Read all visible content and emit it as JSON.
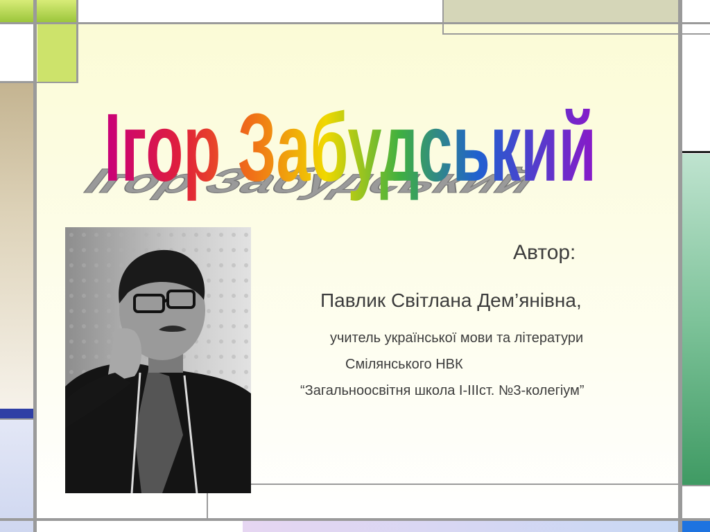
{
  "slide": {
    "title": "Ігор Забудський",
    "author_label": "Автор:",
    "author_name": "Павлик Світлана Дем’янівна,",
    "author_role": "учитель української мови та літератури",
    "author_school": "Смілянського НВК",
    "author_school_full": "“Загальноосвітня школа І-ІІІст. №3-колегіум”"
  },
  "photo": {
    "subject": "portrait-photo"
  },
  "colors": {
    "lime": "#cde36b",
    "lime_dark": "#9cc63c",
    "khaki": "#d5d6b8",
    "tan": "#c4b491",
    "green_top": "#bfe3cf",
    "green_bottom": "#3f9a63",
    "navy": "#2f3fa5",
    "lavender": "#cfd7f0",
    "blue_bar": "#1e73e0"
  }
}
